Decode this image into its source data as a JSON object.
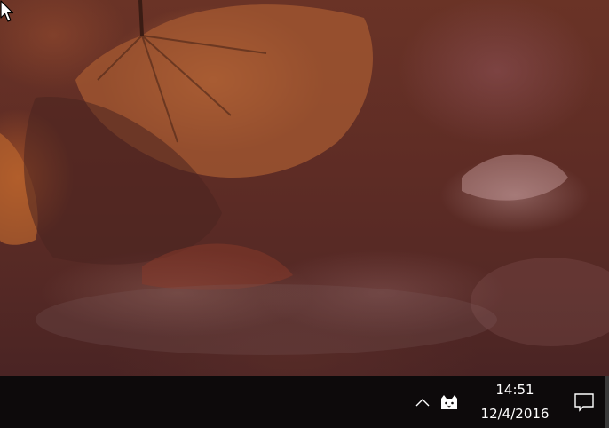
{
  "desktop": {
    "wallpaper": "autumn-leaves",
    "colors": {
      "dominant": "#5e2c25",
      "leaf_highlight": "#b9683a",
      "taskbar": "#0d0a0b",
      "text": "#ffffff"
    }
  },
  "taskbar": {
    "tray": {
      "show_hidden_icons": "chevron-up-icon",
      "app_icon": "cat-icon",
      "clock": {
        "time": "14:51",
        "date": "12/4/2016"
      },
      "action_center_icon": "notification-icon"
    }
  },
  "cursor": "arrow-pointer-icon"
}
